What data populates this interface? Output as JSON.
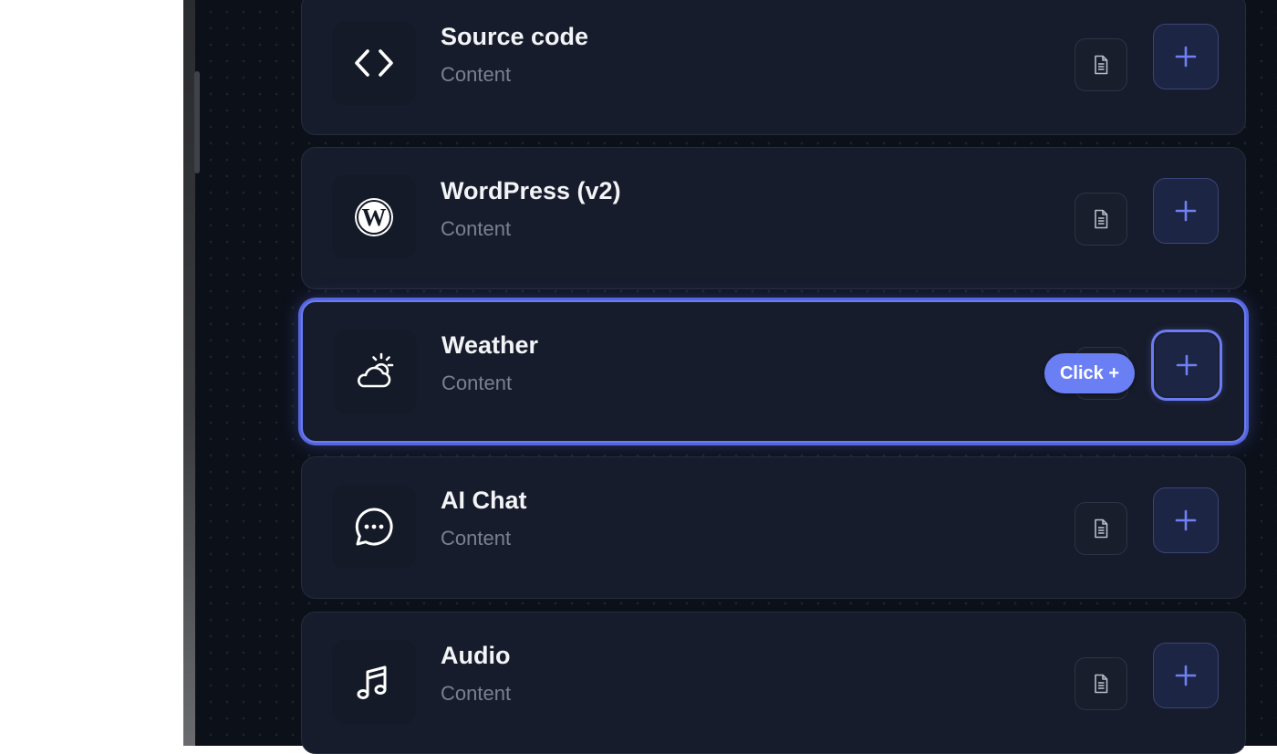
{
  "colors": {
    "accent": "#6b7bf0",
    "card_bg": "#161c2b",
    "panel_bg": "#0c1019",
    "tooltip_bg": "#6b7ff5"
  },
  "blocks": [
    {
      "title": "Source code",
      "subtitle": "Content",
      "icon": "code-brackets-icon",
      "active": false
    },
    {
      "title": "WordPress (v2)",
      "subtitle": "Content",
      "icon": "wordpress-logo-icon",
      "active": false
    },
    {
      "title": "Weather",
      "subtitle": "Content",
      "icon": "partly-cloudy-icon",
      "active": true
    },
    {
      "title": "AI Chat",
      "subtitle": "Content",
      "icon": "chat-bubble-icon",
      "active": false
    },
    {
      "title": "Audio",
      "subtitle": "Content",
      "icon": "music-note-icon",
      "active": false
    }
  ],
  "tooltip": {
    "label": "Click +"
  }
}
